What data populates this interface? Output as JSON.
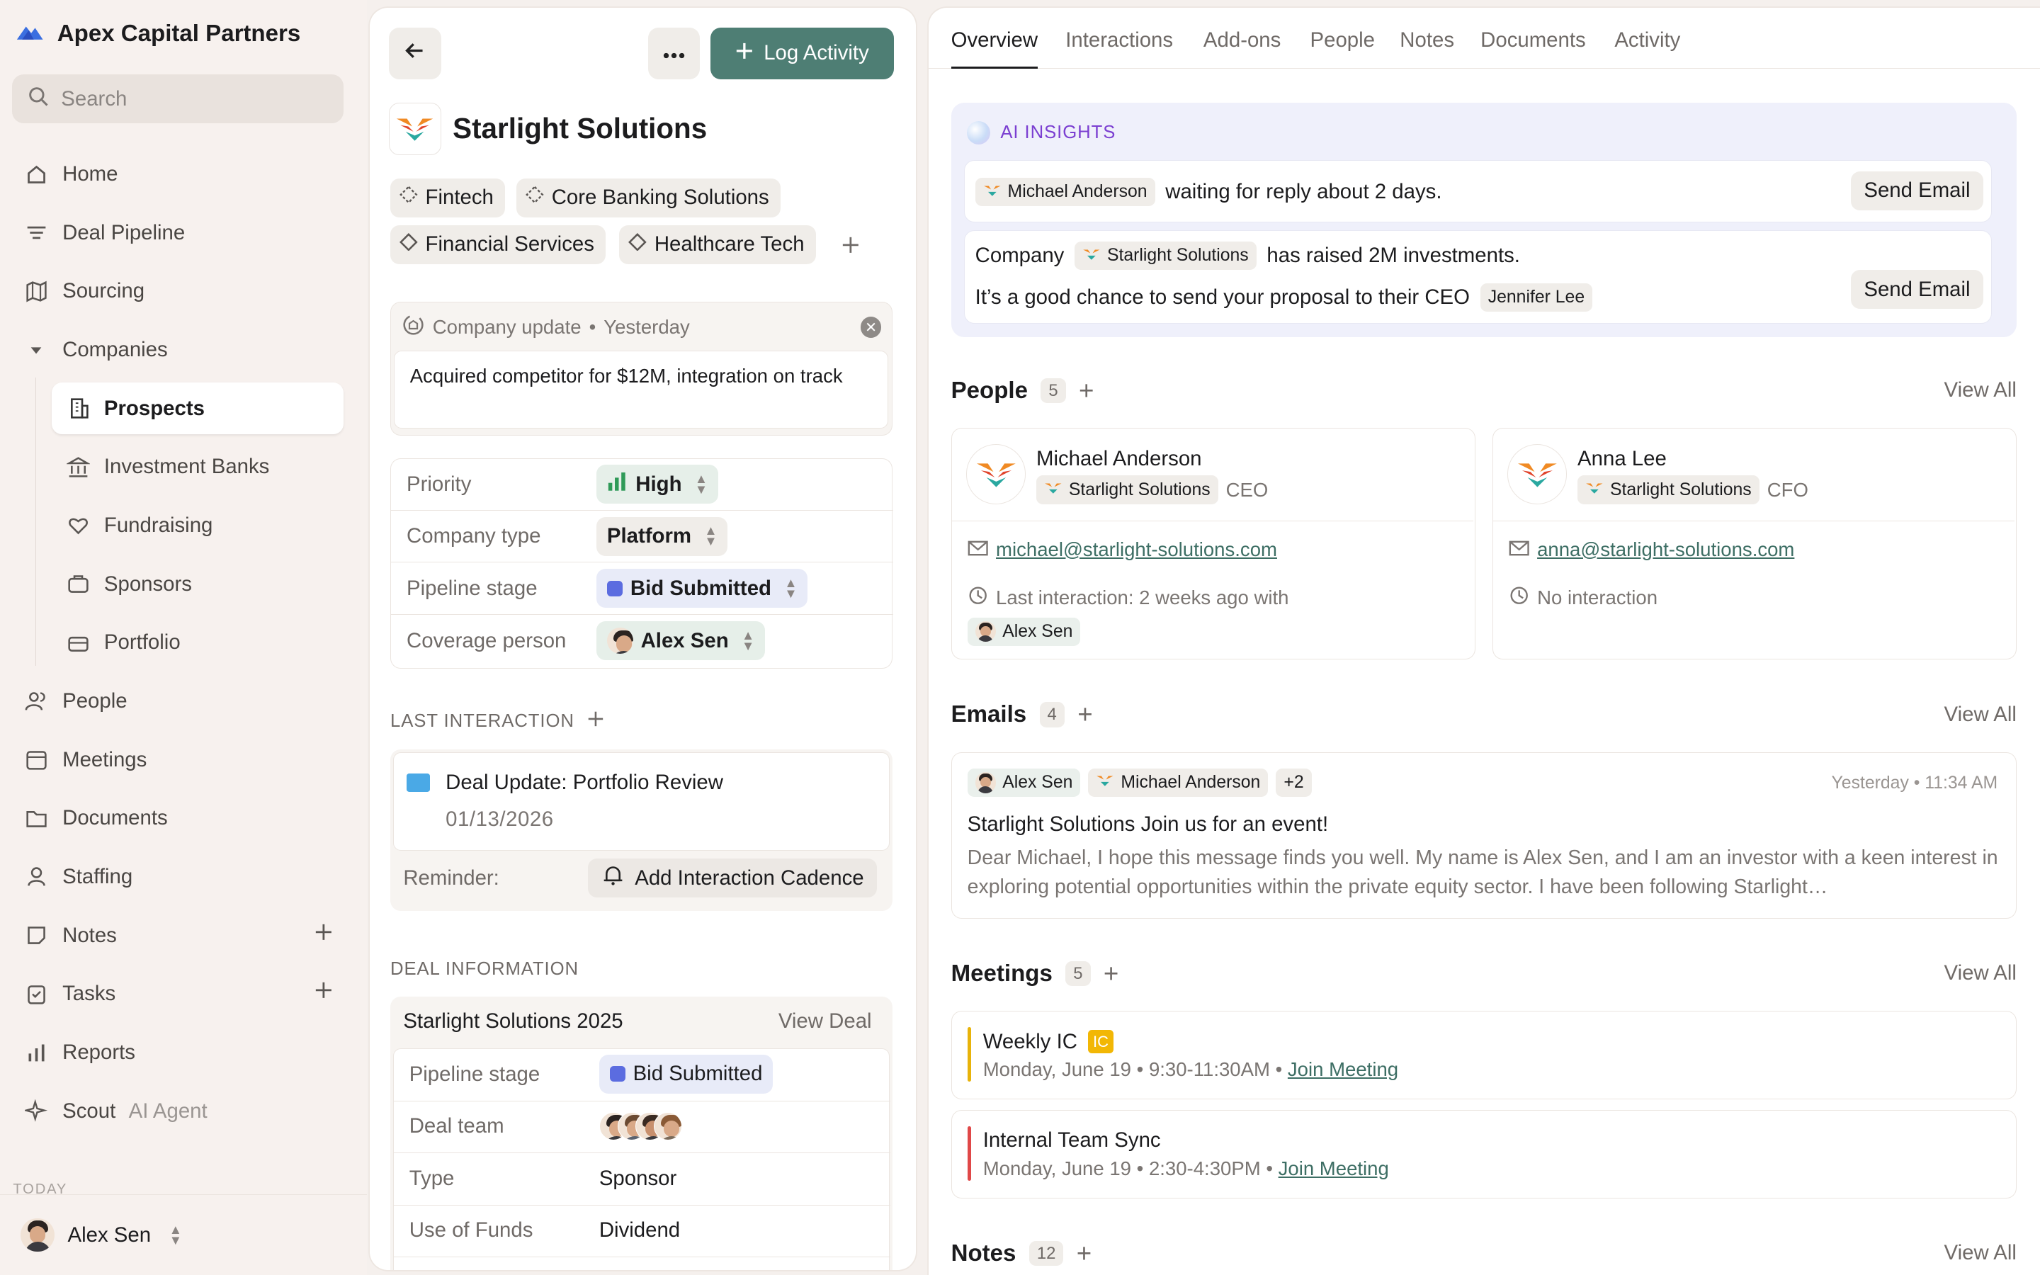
{
  "brand": {
    "name": "Apex Capital Partners"
  },
  "search": {
    "placeholder": "Search"
  },
  "nav": {
    "home": "Home",
    "pipeline": "Deal Pipeline",
    "sourcing": "Sourcing",
    "companies": "Companies",
    "prospects": "Prospects",
    "banks": "Investment Banks",
    "fundraising": "Fundraising",
    "sponsors": "Sponsors",
    "portfolio": "Portfolio",
    "people": "People",
    "meetings": "Meetings",
    "documents": "Documents",
    "staffing": "Staffing",
    "notes": "Notes",
    "tasks": "Tasks",
    "reports": "Reports",
    "scout": "Scout",
    "scout_tag": "AI Agent",
    "today": "TODAY"
  },
  "user": {
    "name": "Alex Sen"
  },
  "company": {
    "name": "Starlight Solutions",
    "log_activity": "Log Activity",
    "tags": [
      "Fintech",
      "Core Banking Solutions",
      "Financial Services",
      "Healthcare Tech"
    ],
    "update_label": "Company update",
    "update_time": "Yesterday",
    "update_text": "Acquired competitor for $12M, integration on track",
    "props": {
      "priority_label": "Priority",
      "priority": "High",
      "type_label": "Company type",
      "type": "Platform",
      "stage_label": "Pipeline stage",
      "stage": "Bid Submitted",
      "coverage_label": "Coverage person",
      "coverage": "Alex Sen"
    },
    "last_interaction_title": "LAST INTERACTION",
    "interaction": {
      "title": "Deal Update: Portfolio Review",
      "date": "01/13/2026"
    },
    "reminder_label": "Reminder:",
    "cadence": "Add Interaction Cadence",
    "deal_info_title": "DEAL INFORMATION",
    "deal": {
      "name": "Starlight Solutions 2025",
      "view": "View Deal",
      "stage_label": "Pipeline stage",
      "stage": "Bid Submitted",
      "team_label": "Deal team",
      "type_label": "Type",
      "type": "Sponsor",
      "funds_label": "Use of Funds",
      "funds": "Dividend"
    }
  },
  "tabs": [
    "Overview",
    "Interactions",
    "Add-ons",
    "People",
    "Notes",
    "Documents",
    "Activity"
  ],
  "ai": {
    "title": "AI INSIGHTS",
    "row1_person": "Michael Anderson",
    "row1_text": "waiting for reply about 2 days.",
    "row2_prefix": "Company",
    "row2_company": "Starlight Solutions",
    "row2_text": "has raised 2M investments.",
    "row2_line2": "It’s a good chance to send your proposal to their CEO",
    "row2_ceo": "Jennifer Lee",
    "send": "Send Email"
  },
  "people": {
    "title": "People",
    "count": "5",
    "view_all": "View All",
    "cards": [
      {
        "name": "Michael Anderson",
        "company": "Starlight Solutions",
        "role": "CEO",
        "email": "michael@starlight-solutions.com",
        "last": "Last interaction: 2 weeks ago with",
        "with": "Alex Sen"
      },
      {
        "name": "Anna Lee",
        "company": "Starlight Solutions",
        "role": "CFO",
        "email": "anna@starlight-solutions.com",
        "last": "No interaction"
      }
    ]
  },
  "emails": {
    "title": "Emails",
    "count": "4",
    "view_all": "View All",
    "from": "Alex Sen",
    "to": "Michael Anderson",
    "more": "+2",
    "time": "Yesterday • 11:34 AM",
    "subject": "Starlight Solutions Join us for an event!",
    "preview": "Dear Michael, I hope this message finds you well. My name is Alex Sen, and I am an investor with a keen interest in exploring potential opportunities within the private equity sector. I have been following Starlight…"
  },
  "meetings": {
    "title": "Meetings",
    "count": "5",
    "view_all": "View All",
    "join": "Join Meeting",
    "items": [
      {
        "title": "Weekly IC",
        "badge": "IC",
        "day": "Monday, June 19",
        "time": "9:30-11:30AM",
        "color": "#e8b30a"
      },
      {
        "title": "Internal Team Sync",
        "day": "Monday, June 19",
        "time": "2:30-4:30PM",
        "color": "#e04848"
      }
    ]
  },
  "notes": {
    "title": "Notes",
    "count": "12",
    "view_all": "View All"
  }
}
